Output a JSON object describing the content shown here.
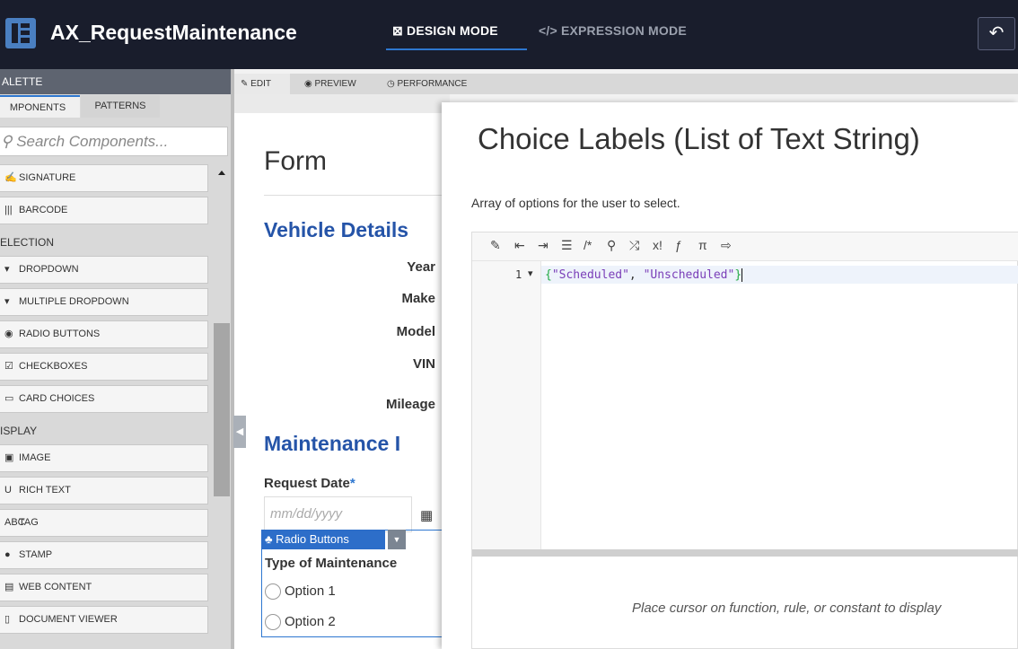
{
  "header": {
    "app_title": "AX_RequestMaintenance",
    "design_mode": "DESIGN MODE",
    "expression_mode": "EXPRESSION MODE",
    "undo_icon": "undo-icon"
  },
  "palette": {
    "header": "ALETTE",
    "tabs": [
      "MPONENTS",
      "PATTERNS"
    ],
    "search_placeholder": "Search Components...",
    "items": [
      {
        "label": "SIGNATURE",
        "icon": "signature-icon",
        "glyph": "✍"
      },
      {
        "label": "BARCODE",
        "icon": "barcode-icon",
        "glyph": "|||"
      },
      {
        "section": "ELECTION"
      },
      {
        "label": "DROPDOWN",
        "icon": "dropdown-icon",
        "glyph": "▾"
      },
      {
        "label": "MULTIPLE DROPDOWN",
        "icon": "multiple-dropdown-icon",
        "glyph": "▾"
      },
      {
        "label": "RADIO BUTTONS",
        "icon": "radio-icon",
        "glyph": "◉"
      },
      {
        "label": "CHECKBOXES",
        "icon": "checkbox-icon",
        "glyph": "☑"
      },
      {
        "label": "CARD CHOICES",
        "icon": "card-choices-icon",
        "glyph": "▭"
      },
      {
        "section": "ISPLAY"
      },
      {
        "label": "IMAGE",
        "icon": "image-icon",
        "glyph": "▣"
      },
      {
        "label": "RICH TEXT",
        "icon": "rich-text-icon",
        "glyph": "U"
      },
      {
        "label": "TAG",
        "icon": "tag-icon",
        "glyph": "abc"
      },
      {
        "label": "STAMP",
        "icon": "stamp-icon",
        "glyph": "●"
      },
      {
        "label": "WEB CONTENT",
        "icon": "web-content-icon",
        "glyph": "▤"
      },
      {
        "label": "DOCUMENT VIEWER",
        "icon": "document-viewer-icon",
        "glyph": "▯"
      }
    ]
  },
  "editor_tabs": {
    "edit": "EDIT",
    "preview": "PREVIEW",
    "performance": "PERFORMANCE"
  },
  "form": {
    "title": "Form",
    "section1": "Vehicle Details",
    "fields": [
      "Year",
      "Make",
      "Model",
      "VIN",
      "Mileage"
    ],
    "section2": "Maintenance I",
    "request_date_label": "Request Date",
    "required_mark": "*",
    "date_placeholder": "mm/dd/yyyy",
    "radio_badge": "Radio Buttons",
    "radio_title": "Type of Maintenance",
    "options": [
      "Option 1",
      "Option 2"
    ]
  },
  "dialog": {
    "title": "Choice Labels (List of Text String)",
    "description": "Array of options for the user to select.",
    "toolbar_icons": [
      "magic-wand-icon",
      "outdent-icon",
      "indent-icon",
      "list-icon",
      "comment-icon",
      "search-icon",
      "shuffle-icon",
      "not-icon",
      "function-icon",
      "pi-icon",
      "export-icon"
    ],
    "toolbar_glyphs": [
      "✎",
      "⇤",
      "⇥",
      "☰",
      "/*",
      "⚲",
      "⤮",
      "x!",
      "ƒ",
      "π",
      "⇨"
    ],
    "line_number": "1",
    "code_open": "{",
    "code_value_1": "\"Scheduled\"",
    "code_sep": ", ",
    "code_value_2": "\"Unscheduled\"",
    "code_close": "}",
    "hint": "Place cursor on function, rule, or constant to display"
  }
}
